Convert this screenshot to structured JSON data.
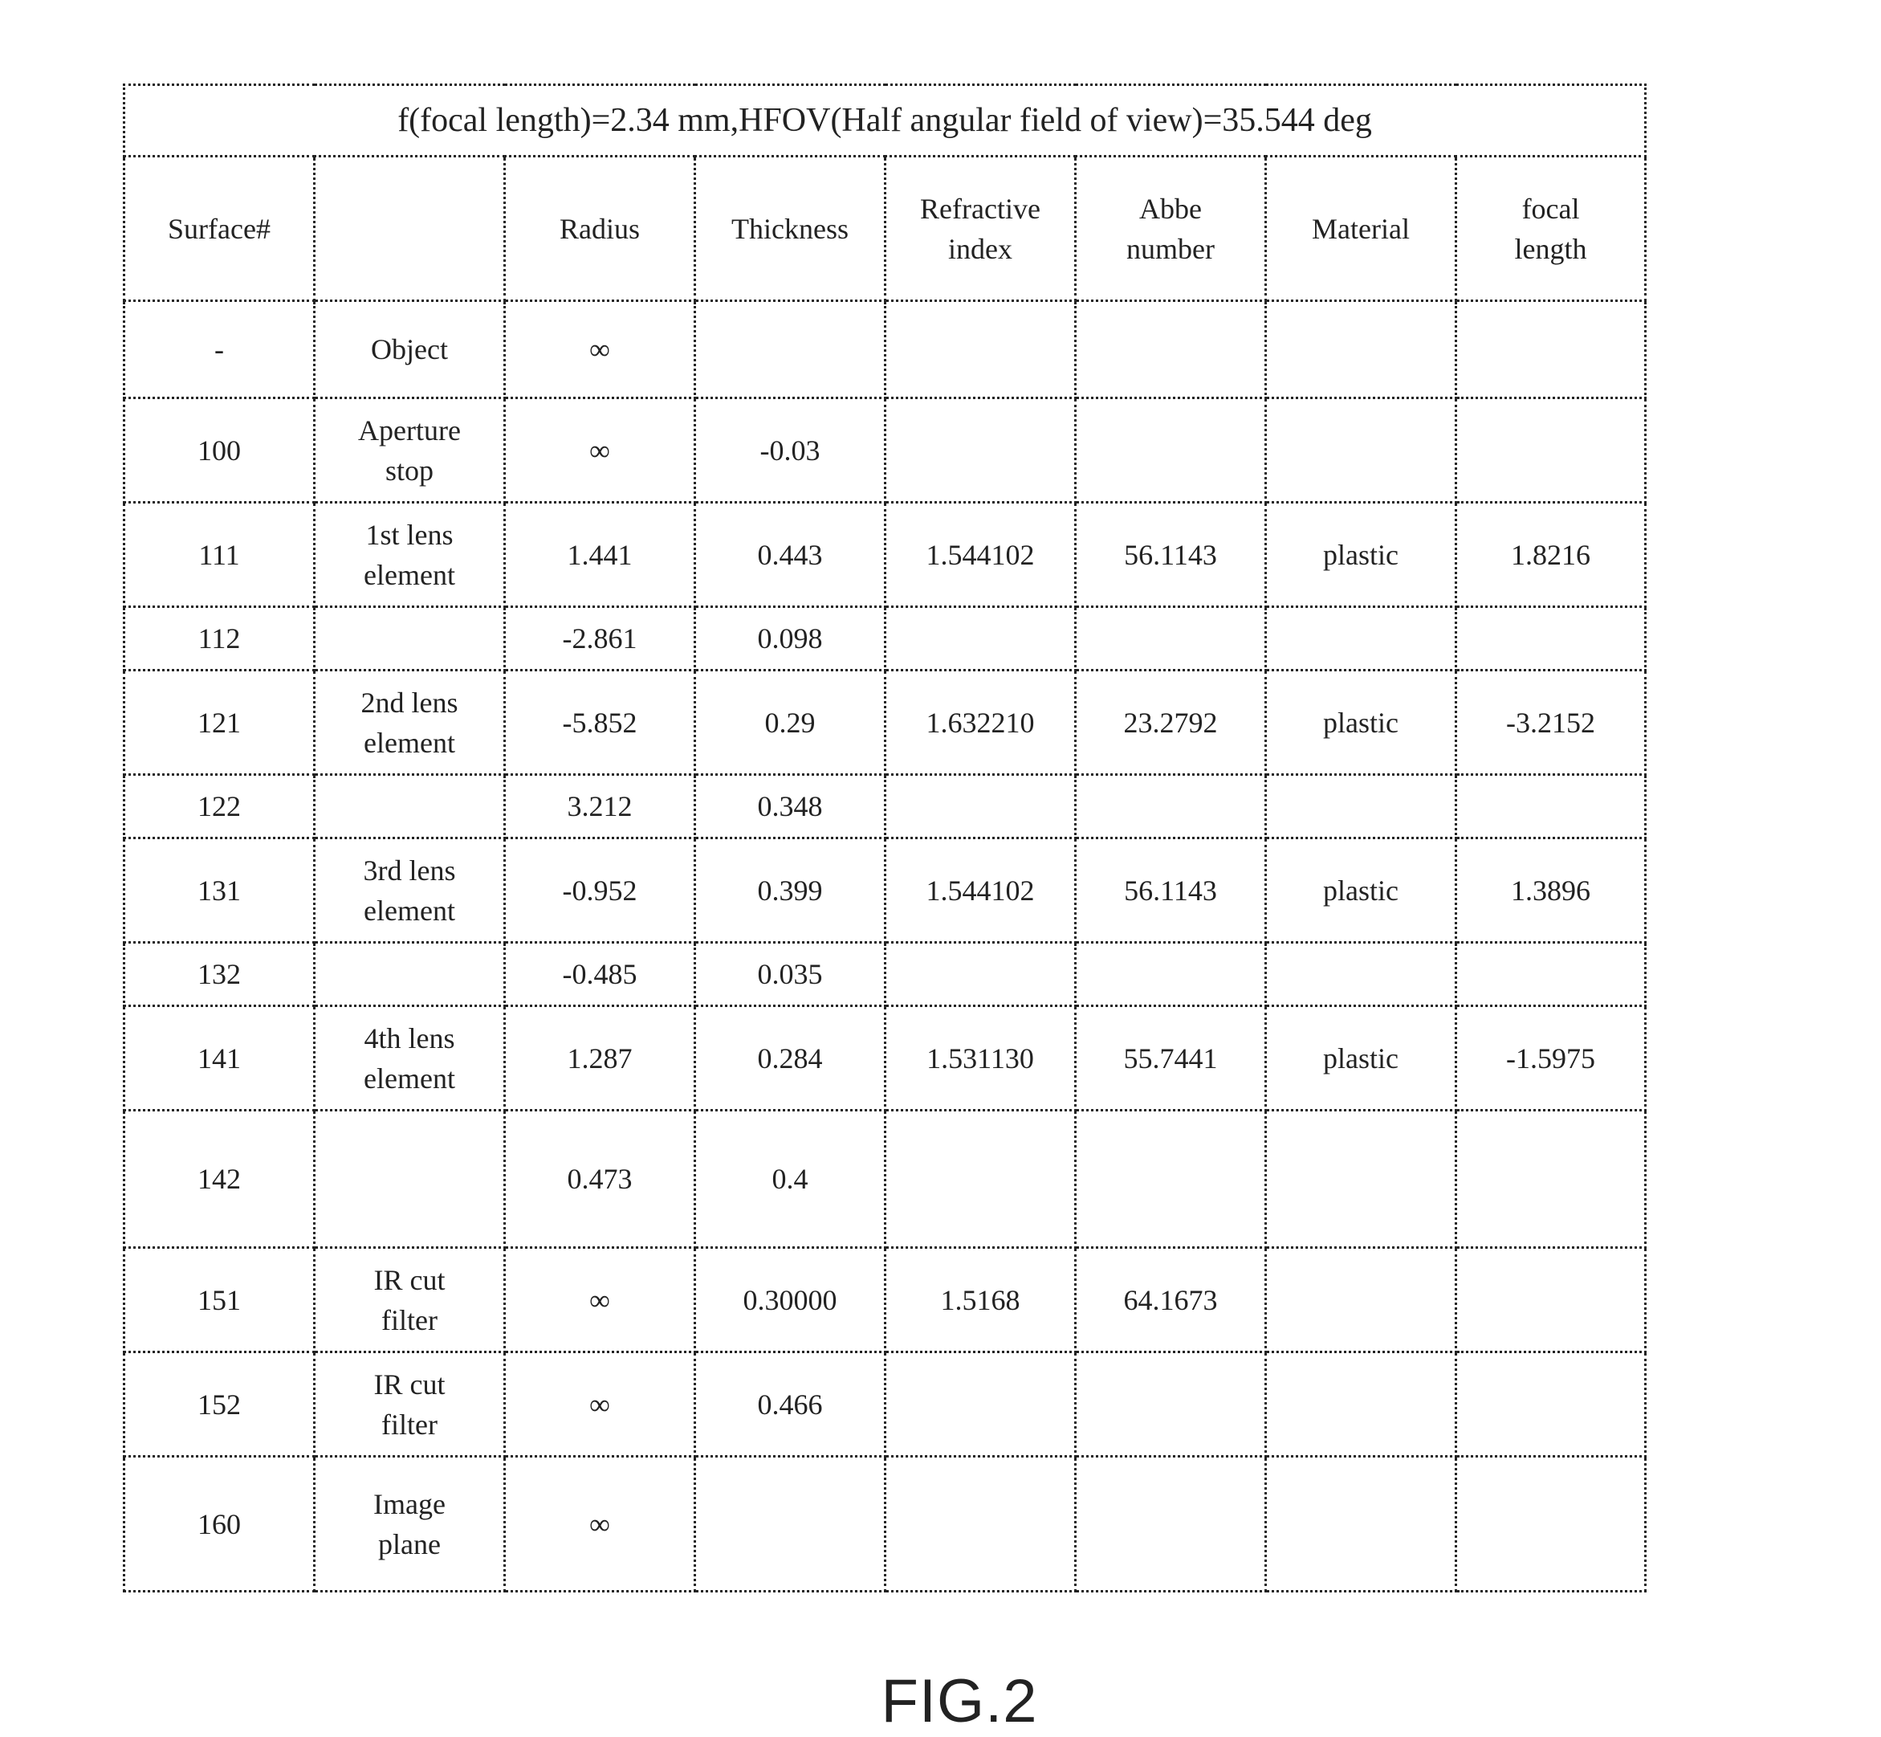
{
  "title": "f(focal length)=2.34 mm,HFOV(Half angular field of view)=35.544 deg",
  "columns": [
    {
      "line1": "Surface#",
      "line2": ""
    },
    {
      "line1": "",
      "line2": ""
    },
    {
      "line1": "Radius",
      "line2": ""
    },
    {
      "line1": "Thickness",
      "line2": ""
    },
    {
      "line1": "Refractive",
      "line2": "index"
    },
    {
      "line1": "Abbe",
      "line2": "number"
    },
    {
      "line1": "Material",
      "line2": ""
    },
    {
      "line1": "focal",
      "line2": "length"
    }
  ],
  "rows": [
    {
      "surface": "-",
      "name1": "Object",
      "name2": "",
      "radius": "∞",
      "thickness": "",
      "index": "",
      "abbe": "",
      "material": "",
      "focal": ""
    },
    {
      "surface": "100",
      "name1": "Aperture",
      "name2": "stop",
      "radius": "∞",
      "thickness": "-0.03",
      "index": "",
      "abbe": "",
      "material": "",
      "focal": ""
    },
    {
      "surface": "111",
      "name1": "1st lens",
      "name2": "element",
      "radius": "1.441",
      "thickness": "0.443",
      "index": "1.544102",
      "abbe": "56.1143",
      "material": "plastic",
      "focal": "1.8216"
    },
    {
      "surface": "112",
      "name1": "",
      "name2": "",
      "radius": "-2.861",
      "thickness": "0.098",
      "index": "",
      "abbe": "",
      "material": "",
      "focal": ""
    },
    {
      "surface": "121",
      "name1": "2nd lens",
      "name2": "element",
      "radius": "-5.852",
      "thickness": "0.29",
      "index": "1.632210",
      "abbe": "23.2792",
      "material": "plastic",
      "focal": "-3.2152"
    },
    {
      "surface": "122",
      "name1": "",
      "name2": "",
      "radius": "3.212",
      "thickness": "0.348",
      "index": "",
      "abbe": "",
      "material": "",
      "focal": ""
    },
    {
      "surface": "131",
      "name1": "3rd lens",
      "name2": "element",
      "radius": "-0.952",
      "thickness": "0.399",
      "index": "1.544102",
      "abbe": "56.1143",
      "material": "plastic",
      "focal": "1.3896"
    },
    {
      "surface": "132",
      "name1": "",
      "name2": "",
      "radius": "-0.485",
      "thickness": "0.035",
      "index": "",
      "abbe": "",
      "material": "",
      "focal": ""
    },
    {
      "surface": "141",
      "name1": "4th lens",
      "name2": "element",
      "radius": "1.287",
      "thickness": "0.284",
      "index": "1.531130",
      "abbe": "55.7441",
      "material": "plastic",
      "focal": "-1.5975"
    },
    {
      "surface": "142",
      "name1": "",
      "name2": "",
      "radius": "0.473",
      "thickness": "0.4",
      "index": "",
      "abbe": "",
      "material": "",
      "focal": ""
    },
    {
      "surface": "151",
      "name1": "IR cut",
      "name2": "filter",
      "radius": "∞",
      "thickness": "0.30000",
      "index": "1.5168",
      "abbe": "64.1673",
      "material": "",
      "focal": ""
    },
    {
      "surface": "152",
      "name1": "IR cut",
      "name2": "filter",
      "radius": "∞",
      "thickness": "0.466",
      "index": "",
      "abbe": "",
      "material": "",
      "focal": ""
    },
    {
      "surface": "160",
      "name1": "Image",
      "name2": "plane",
      "radius": "∞",
      "thickness": "",
      "index": "",
      "abbe": "",
      "material": "",
      "focal": ""
    }
  ],
  "figure_label": "FIG.2"
}
